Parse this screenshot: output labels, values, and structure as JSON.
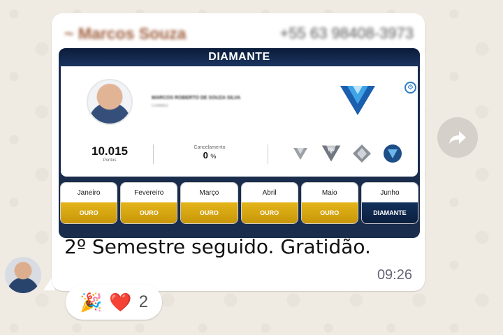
{
  "message": {
    "sender_name": "~ Marcos Souza",
    "sender_phone": "+55 63 98408-3973",
    "text": "2º Semestre seguido. Gratidão.",
    "time": "09:26"
  },
  "card": {
    "title": "DIAMANTE",
    "member_name": "MARCOS ROBERTO DE SOUZA SILVA",
    "member_subtitle": "CAMBIO",
    "points_value": "10.015",
    "points_label": "Pontos",
    "cancel_label": "Cancelamento",
    "cancel_value": "0",
    "cancel_unit": "%",
    "badge_tdv": "TDV",
    "months": [
      {
        "name": "Janeiro",
        "level": "OURO"
      },
      {
        "name": "Fevereiro",
        "level": "OURO"
      },
      {
        "name": "Março",
        "level": "OURO"
      },
      {
        "name": "Abril",
        "level": "OURO"
      },
      {
        "name": "Maio",
        "level": "OURO"
      },
      {
        "name": "Junho",
        "level": "DIAMANTE"
      }
    ]
  },
  "reactions": {
    "emoji_1": "🎉",
    "emoji_2": "❤️",
    "count": "2"
  },
  "colors": {
    "gold": "#d9a914",
    "navy": "#0b1f3f",
    "diamond_blue": "#1f6fc0"
  },
  "icons": [
    "gear-icon",
    "diamond-logo-icon",
    "forward-icon",
    "party-popper-icon",
    "heart-icon"
  ]
}
